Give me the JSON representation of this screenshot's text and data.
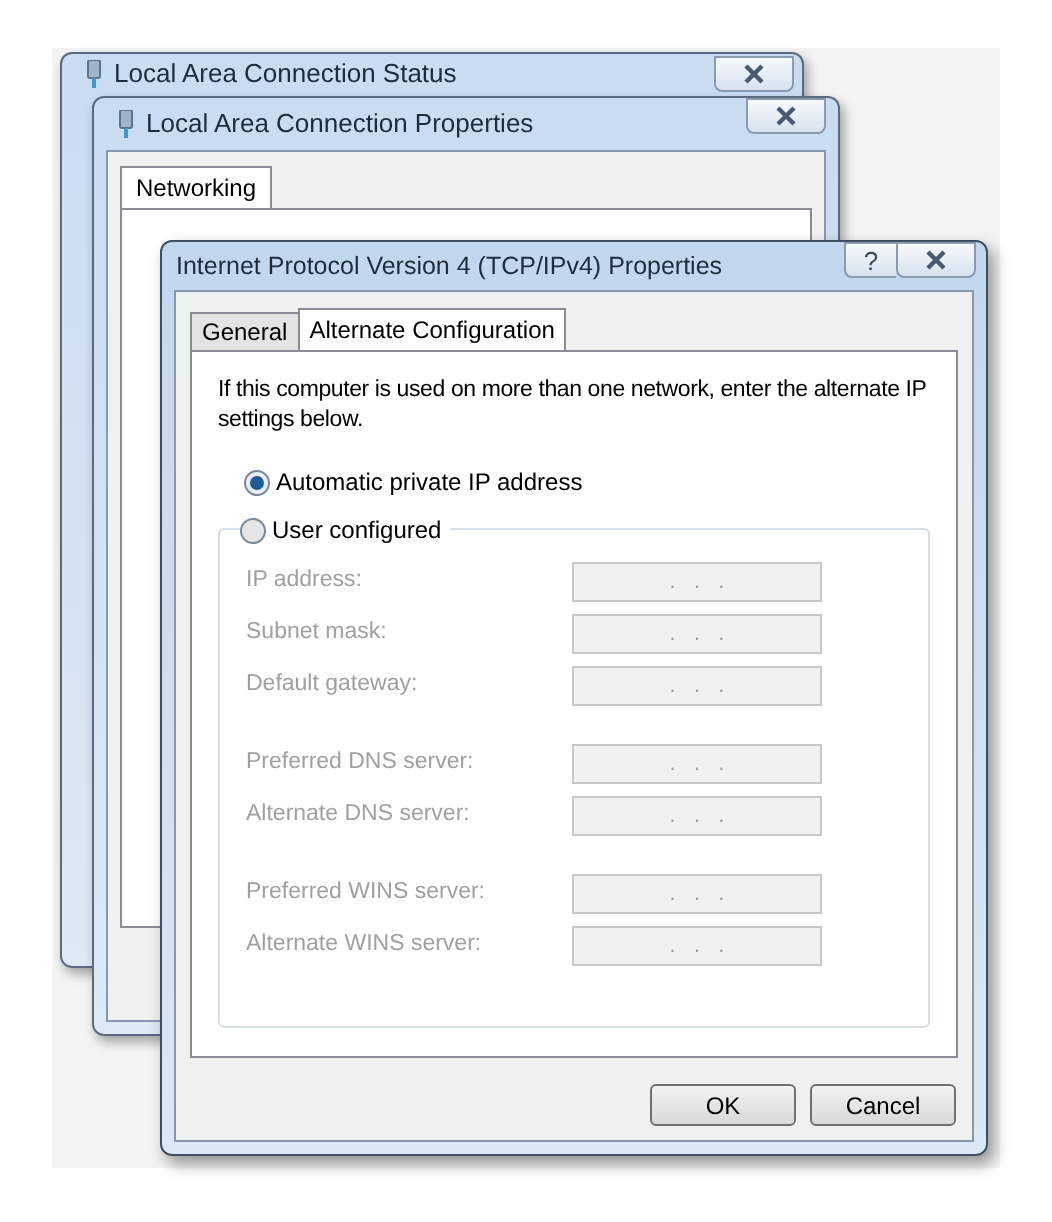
{
  "back_windows": [
    {
      "title": "Local Area Connection Status"
    },
    {
      "title": "Local Area Connection Properties",
      "tabs": [
        {
          "label": "Networking",
          "selected": true
        }
      ]
    }
  ],
  "dialog": {
    "title": "Internet Protocol Version 4 (TCP/IPv4) Properties",
    "help": "?",
    "tabs": [
      {
        "label": "General",
        "selected": false
      },
      {
        "label": "Alternate Configuration",
        "selected": true
      }
    ],
    "intro": "If this computer is used on more than one network, enter the alternate IP settings below.",
    "options": [
      {
        "label": "Automatic private IP address",
        "selected": true
      },
      {
        "label": "User configured",
        "selected": false
      }
    ],
    "user_configured": {
      "disabled": true,
      "groups": [
        [
          {
            "label": "IP address:",
            "value": ".   .   ."
          },
          {
            "label": "Subnet mask:",
            "value": ".   .   ."
          },
          {
            "label": "Default gateway:",
            "value": ".   .   ."
          }
        ],
        [
          {
            "label": "Preferred DNS server:",
            "value": ".   .   ."
          },
          {
            "label": "Alternate DNS server:",
            "value": ".   .   ."
          }
        ],
        [
          {
            "label": "Preferred WINS server:",
            "value": ".   .   ."
          },
          {
            "label": "Alternate WINS server:",
            "value": ".   .   ."
          }
        ]
      ]
    },
    "buttons": [
      "OK",
      "Cancel"
    ]
  }
}
